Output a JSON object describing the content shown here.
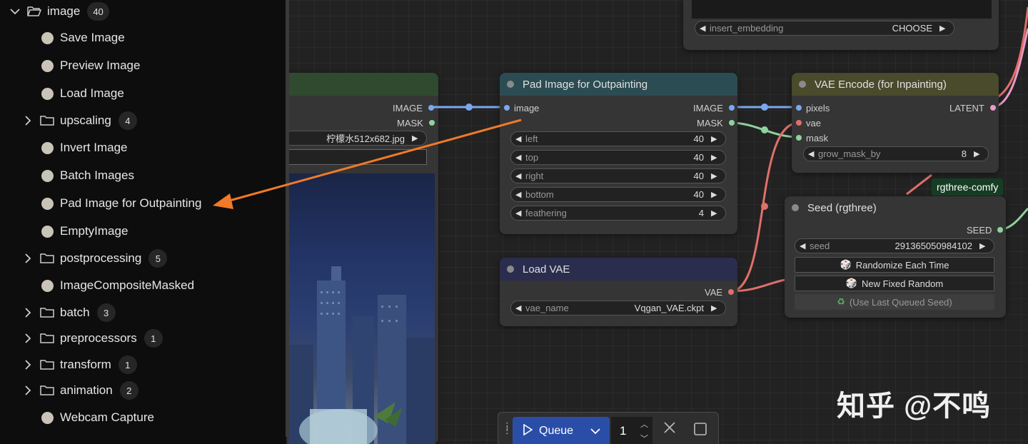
{
  "sidebar": {
    "root": {
      "label": "image",
      "count": "40"
    },
    "items": [
      {
        "type": "node",
        "label": "Save Image"
      },
      {
        "type": "node",
        "label": "Preview Image"
      },
      {
        "type": "node",
        "label": "Load Image"
      },
      {
        "type": "folder",
        "label": "upscaling",
        "count": "4"
      },
      {
        "type": "node",
        "label": "Invert Image"
      },
      {
        "type": "node",
        "label": "Batch Images"
      },
      {
        "type": "node",
        "label": "Pad Image for Outpainting"
      },
      {
        "type": "node",
        "label": "EmptyImage"
      },
      {
        "type": "folder",
        "label": "postprocessing",
        "count": "5"
      },
      {
        "type": "node",
        "label": "ImageCompositeMasked"
      },
      {
        "type": "folder",
        "label": "batch",
        "count": "3"
      },
      {
        "type": "folder",
        "label": "preprocessors",
        "count": "1"
      },
      {
        "type": "folder",
        "label": "transform",
        "count": "1"
      },
      {
        "type": "folder",
        "label": "animation",
        "count": "2"
      },
      {
        "type": "node",
        "label": "Webcam Capture"
      }
    ]
  },
  "load_image_node": {
    "out_image": "IMAGE",
    "out_mask": "MASK",
    "file": "柠檬水512x682.jpg"
  },
  "embed_node": {
    "widget_label": "insert_embedding",
    "widget_value": "CHOOSE"
  },
  "pad_node": {
    "title": "Pad Image for Outpainting",
    "in_image": "image",
    "out_image": "IMAGE",
    "out_mask": "MASK",
    "widgets": [
      {
        "label": "left",
        "value": "40"
      },
      {
        "label": "top",
        "value": "40"
      },
      {
        "label": "right",
        "value": "40"
      },
      {
        "label": "bottom",
        "value": "40"
      },
      {
        "label": "feathering",
        "value": "4"
      }
    ]
  },
  "vae_encode_node": {
    "title": "VAE Encode (for Inpainting)",
    "in_pixels": "pixels",
    "in_vae": "vae",
    "in_mask": "mask",
    "out_latent": "LATENT",
    "widget_label": "grow_mask_by",
    "widget_value": "8"
  },
  "load_vae_node": {
    "title": "Load VAE",
    "out_vae": "VAE",
    "widget_label": "vae_name",
    "widget_value": "Vqgan_VAE.ckpt"
  },
  "seed_node": {
    "badge": "rgthree-comfy",
    "title": "Seed (rgthree)",
    "out_seed": "SEED",
    "widget_label": "seed",
    "widget_value": "291365050984102",
    "btn_randomize": "Randomize Each Time",
    "btn_fixed": "New Fixed Random",
    "btn_last": "(Use Last Queued Seed)"
  },
  "queue": {
    "label": "Queue",
    "count": "1"
  },
  "watermark": "知乎 @不鸣",
  "colors": {
    "image_wire": "#7aa8f0",
    "mask_wire": "#8fd19e",
    "vae_wire": "#e0706a",
    "latent_wire": "#e89acb",
    "annotation_arrow": "#f07a28"
  }
}
